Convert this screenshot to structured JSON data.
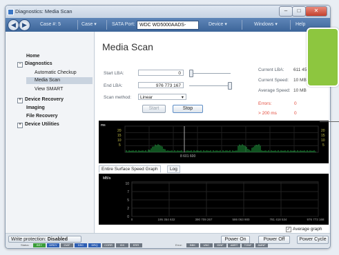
{
  "window": {
    "title": "Diagnostics: Media Scan"
  },
  "toolbar": {
    "case_label": "Case #: 5",
    "case_menu": "Case",
    "sata_label": "SATA Port:",
    "drive": "WDC WD5000AADS-",
    "device_menu": "Device",
    "windows_menu": "Windows",
    "help_menu": "Help"
  },
  "sidebar": {
    "items": [
      {
        "label": "Home",
        "bold": true
      },
      {
        "label": "Diagnostics",
        "bold": true,
        "expander": "⊟"
      },
      {
        "label": "Automatic Checkup"
      },
      {
        "label": "Media Scan",
        "selected": true
      },
      {
        "label": "View SMART"
      },
      {
        "label": "Device Recovery",
        "bold": true,
        "expander": "⊞"
      },
      {
        "label": "Imaging",
        "bold": true
      },
      {
        "label": "File Recovery",
        "bold": true
      },
      {
        "label": "Device Utilities",
        "bold": true,
        "expander": "⊞"
      }
    ]
  },
  "scan": {
    "heading": "Media Scan",
    "start_lba_label": "Start LBA:",
    "start_lba_value": "0",
    "end_lba_label": "End LBA:",
    "end_lba_value": "976 773 167",
    "method_label": "Scan method:",
    "method_value": "Linear",
    "start_button": "Start",
    "stop_button": "Stop"
  },
  "stats": {
    "current_lba_label": "Current LBA:",
    "current_lba_value": "611 45",
    "current_speed_label": "Current Speed:",
    "current_speed_value": "10 MB",
    "average_speed_label": "Average Speed:",
    "average_speed_value": "10 MB",
    "errors_label": "Errors:",
    "errors_value": "0",
    "slow_label": "> 200 ms",
    "slow_value": "0"
  },
  "top_graph": {
    "left_scale": [
      "ms",
      "20",
      "15",
      "10",
      "5"
    ],
    "right_scale": [
      "20",
      "15",
      "10",
      "5"
    ],
    "marker_label": "8 601 600"
  },
  "tabs": [
    {
      "label": "Entire Surface Speed Graph",
      "active": true
    },
    {
      "label": "Log",
      "active": false
    }
  ],
  "chart_data": {
    "type": "line",
    "ylabel": "MB/s",
    "y_ticks": [
      "10",
      "7",
      "5",
      "2",
      "0"
    ],
    "x_ticks": [
      "195 354 632",
      "390 709 267",
      "586 063 900",
      "781 418 534",
      "976 773 168"
    ],
    "series": []
  },
  "average_graph": {
    "label": "Average graph",
    "checked": true
  },
  "statusbar": {
    "write_protection_label": "Write protection:",
    "write_protection_value": "Disabled",
    "power_on": "Power On",
    "power_off": "Power Off",
    "power_cycle": "Power Cycle",
    "status_label": "Status:",
    "status_flags": [
      "BSY",
      "DRDY",
      "DWF",
      "DSC",
      "DRQ",
      "CORR",
      "IDX",
      "ERR"
    ],
    "error_label": "Error:",
    "error_flags": [
      "BBK",
      "UNC",
      "IDNF",
      "ABRT",
      "TONF",
      "AMNF"
    ],
    "active_color": "#2e5fb3",
    "ok_color": "#3a9d3a"
  },
  "colors": {
    "accent_green": "#8dc63f",
    "graph_green": "#27c24c",
    "toolbar_blue": "#4a73aa"
  }
}
